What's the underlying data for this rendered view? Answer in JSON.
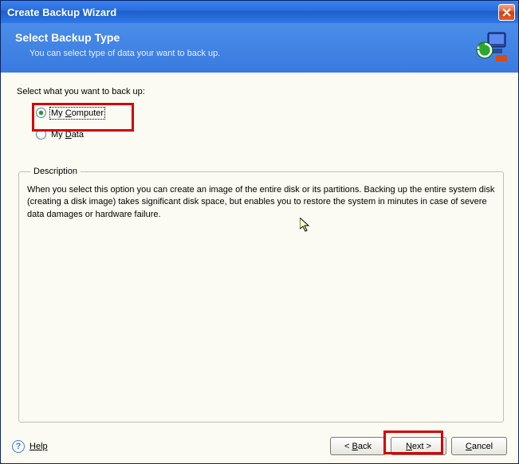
{
  "window": {
    "title": "Create Backup Wizard"
  },
  "header": {
    "title": "Select Backup Type",
    "subtitle": "You can select type of data your want to back up."
  },
  "content": {
    "prompt": "Select what you want to back up:",
    "options": {
      "my_computer": {
        "label": "My Computer",
        "accel": "C",
        "checked": true
      },
      "my_data": {
        "label": "My Data",
        "accel": "D",
        "checked": false
      }
    }
  },
  "description": {
    "legend": "Description",
    "text": "When you select this option you can create an image of the entire disk or its partitions. Backing up the entire system disk (creating a disk image) takes significant disk space, but enables you to restore the system in minutes in case of severe data damages or hardware failure."
  },
  "footer": {
    "help": "Help",
    "back": "< Back",
    "next": "Next >",
    "cancel": "Cancel"
  }
}
